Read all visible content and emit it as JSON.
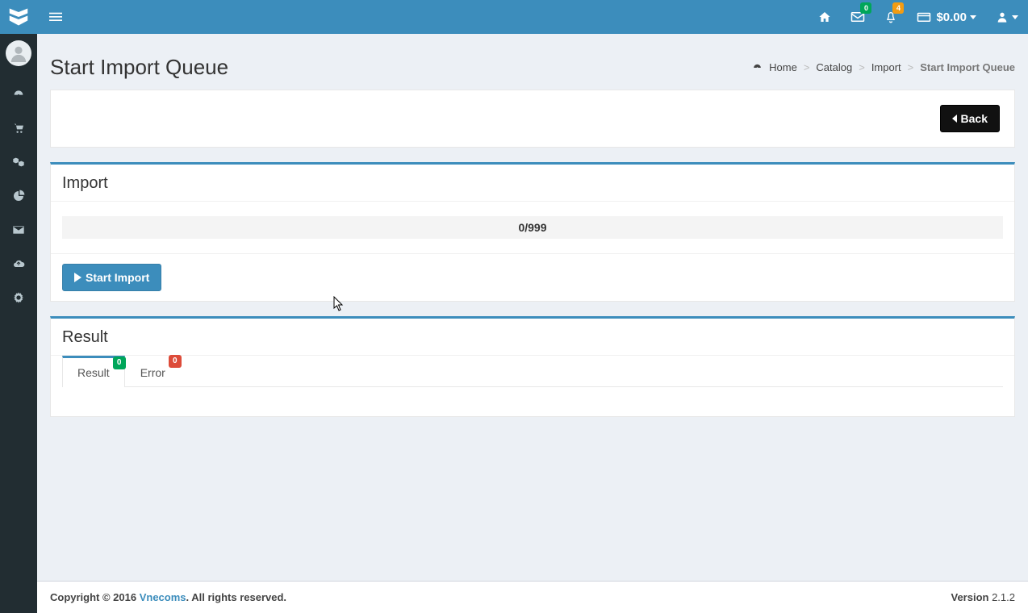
{
  "header": {
    "badges": {
      "mail": "0",
      "bell": "4"
    },
    "money": "$0.00"
  },
  "page": {
    "title": "Start Import Queue",
    "breadcrumb": [
      "Home",
      "Catalog",
      "Import",
      "Start Import Queue"
    ],
    "back_label": "Back"
  },
  "import_panel": {
    "title": "Import",
    "progress_text": "0/999",
    "start_label": "Start Import"
  },
  "result_panel": {
    "title": "Result",
    "tabs": [
      {
        "label": "Result",
        "count": "0",
        "style": "green"
      },
      {
        "label": "Error",
        "count": "0",
        "style": "red"
      }
    ]
  },
  "footer": {
    "copyright_prefix": "Copyright © 2016 ",
    "brand": "Vnecoms",
    "copyright_suffix": ". All rights reserved.",
    "version_label": "Version ",
    "version": "2.1.2"
  }
}
